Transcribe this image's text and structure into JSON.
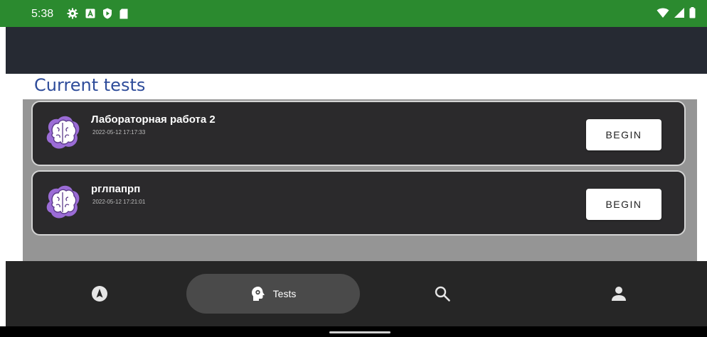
{
  "status_bar": {
    "time": "5:38",
    "left_icons": [
      "gear-icon",
      "a-box-icon",
      "play-shield-icon",
      "sd-card-icon"
    ],
    "right_icons": [
      "wifi-icon",
      "signal-icon",
      "battery-icon"
    ]
  },
  "page": {
    "title": "Current tests"
  },
  "tests": [
    {
      "name": "Лабораторная работа 2",
      "date": "2022-05-12 17:17:33",
      "button_label": "BEGIN"
    },
    {
      "name": "рглпапрп",
      "date": "2022-05-12 17:21:01",
      "button_label": "BEGIN"
    }
  ],
  "bottom_nav": {
    "items": [
      {
        "icon": "compass-icon",
        "label": ""
      },
      {
        "icon": "brain-gear-icon",
        "label": "Tests",
        "selected": true
      },
      {
        "icon": "search-icon",
        "label": ""
      },
      {
        "icon": "person-icon",
        "label": ""
      }
    ]
  },
  "colors": {
    "status_bar": "#2b8a2f",
    "app_bar": "#262a33",
    "title": "#2e4c9a",
    "content_bg": "#959595",
    "card_bg": "#2b2a2c",
    "avatar": "#9b6cd6",
    "bottom_nav": "#262626",
    "nav_selected": "#4a4a4a"
  }
}
